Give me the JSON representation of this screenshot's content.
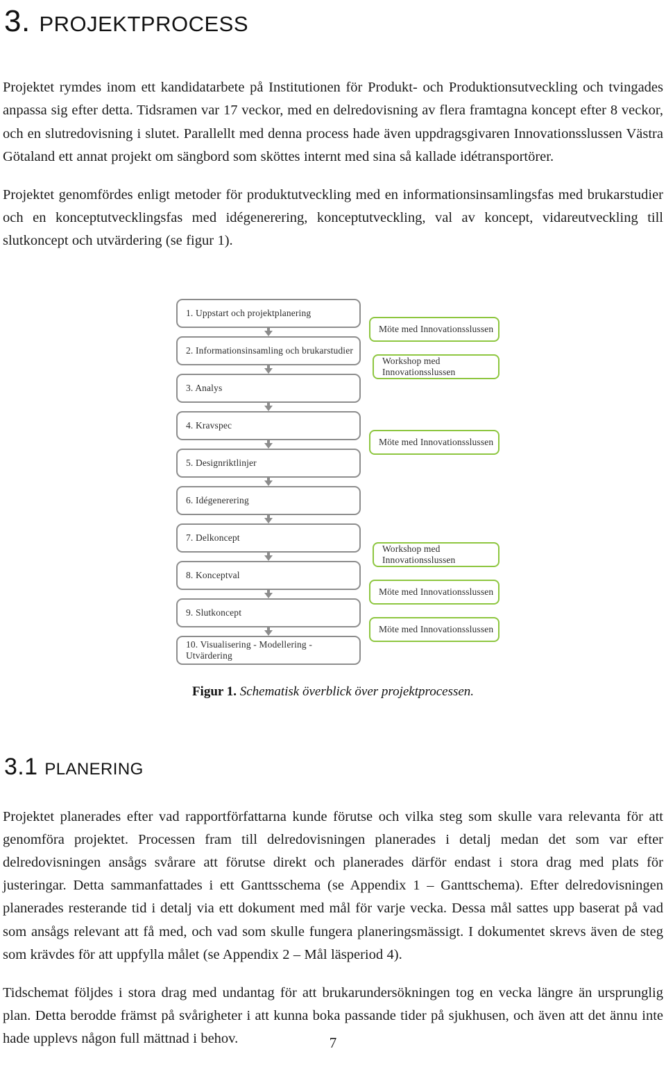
{
  "document": {
    "page_number": "7",
    "heading_1": {
      "number": "3.",
      "title": "Projektprocess"
    },
    "heading_2": {
      "number": "3.1",
      "title": "Planering"
    }
  },
  "paragraphs": {
    "p1": "Projektet rymdes inom ett kandidatarbete på Institutionen för Produkt- och Produktionsutveckling och tvingades anpassa sig efter detta. Tidsramen var 17 veckor, med en delredovisning av flera framtagna koncept efter 8 veckor, och en slutredovisning i slutet. Parallellt med denna process hade även uppdragsgivaren Innovationsslussen Västra Götaland ett annat projekt om sängbord som sköttes internt med sina så kallade idétransportörer.",
    "p2": "Projektet genomfördes enligt metoder för produktutveckling med en informationsinsamlingsfas med brukarstudier och en konceptutvecklingsfas med idégenerering, konceptutveckling, val av koncept, vidareutveckling till slutkoncept och utvärdering (se figur 1).",
    "p3": "Projektet planerades efter vad rapportförfattarna kunde förutse och vilka steg som skulle vara relevanta för att genomföra projektet. Processen fram till delredovisningen planerades i detalj medan det som var efter delredovisningen ansågs svårare att förutse direkt och planerades därför endast i stora drag med plats för justeringar. Detta sammanfattades i ett Ganttsschema (se Appendix 1 – Ganttschema). Efter delredovisningen planerades resterande tid i detalj via ett dokument med mål för varje vecka. Dessa mål sattes upp baserat på vad som ansågs relevant att få med, och vad som skulle fungera planeringsmässigt. I dokumentet skrevs även de steg som krävdes för att uppfylla målet (se Appendix 2 – Mål läsperiod 4).",
    "p4": "Tidschemat följdes i stora drag med undantag för att brukarundersökningen tog en vecka längre än ursprunglig plan. Detta berodde främst på svårigheter i att kunna boka passande tider på sjukhusen, och även att det ännu inte hade upplevs någon full mättnad i behov."
  },
  "figure": {
    "caption_label": "Figur 1.",
    "caption_text": "Schematisk överblick över projektprocessen.",
    "colors": {
      "process_border": "#8c8c8c",
      "note_border": "#8dc63f",
      "arrow": "#8c8c8c"
    },
    "process_steps": [
      {
        "label": "1. Uppstart och projektplanering"
      },
      {
        "label": "2. Informationsinsamling och brukarstudier"
      },
      {
        "label": "3. Analys"
      },
      {
        "label": "4. Kravspec"
      },
      {
        "label": "5. Designriktlinjer"
      },
      {
        "label": "6. Idégenerering"
      },
      {
        "label": "7. Delkoncept"
      },
      {
        "label": "8. Konceptval"
      },
      {
        "label": "9. Slutkoncept"
      },
      {
        "label": "10. Visualisering - Modellering - Utvärdering"
      }
    ],
    "notes": [
      {
        "label": "Möte med Innovationsslussen"
      },
      {
        "label": "Workshop med Innovationsslussen"
      },
      {
        "label": "Möte med Innovationsslussen"
      },
      {
        "label": "Workshop med Innovationsslussen"
      },
      {
        "label": "Möte med Innovationsslussen"
      },
      {
        "label": "Möte med Innovationsslussen"
      }
    ]
  }
}
